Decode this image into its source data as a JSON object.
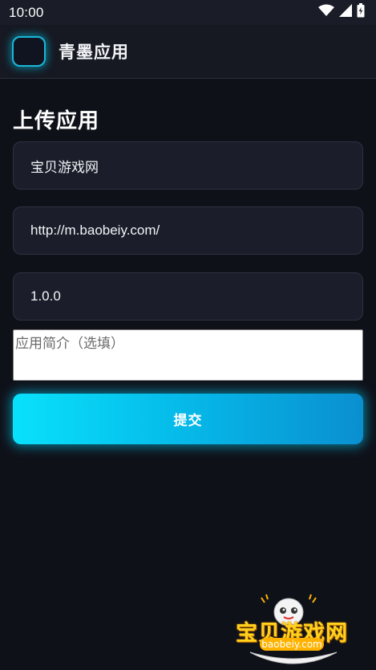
{
  "status_bar": {
    "time": "10:00",
    "icons": [
      "wifi-icon",
      "signal-icon",
      "battery-icon"
    ]
  },
  "app_bar": {
    "title": "青墨应用",
    "logo_icon": "app-logo-icon"
  },
  "page": {
    "heading": "上传应用"
  },
  "form": {
    "name_value": "宝贝游戏网",
    "url_value": "http://m.baobeiy.com/",
    "version_value": "1.0.0",
    "description_placeholder": "应用简介（选填）",
    "submit_label": "提交"
  },
  "watermark": {
    "brand_text": "宝贝游戏网",
    "brand_url": "baobeiy.com"
  },
  "colors": {
    "background": "#0f1119",
    "accent_cyan": "#08e1fb",
    "accent_blue": "#0a8fd0",
    "field_bg": "#1b1e2a",
    "watermark_yellow": "#ffd21e"
  }
}
